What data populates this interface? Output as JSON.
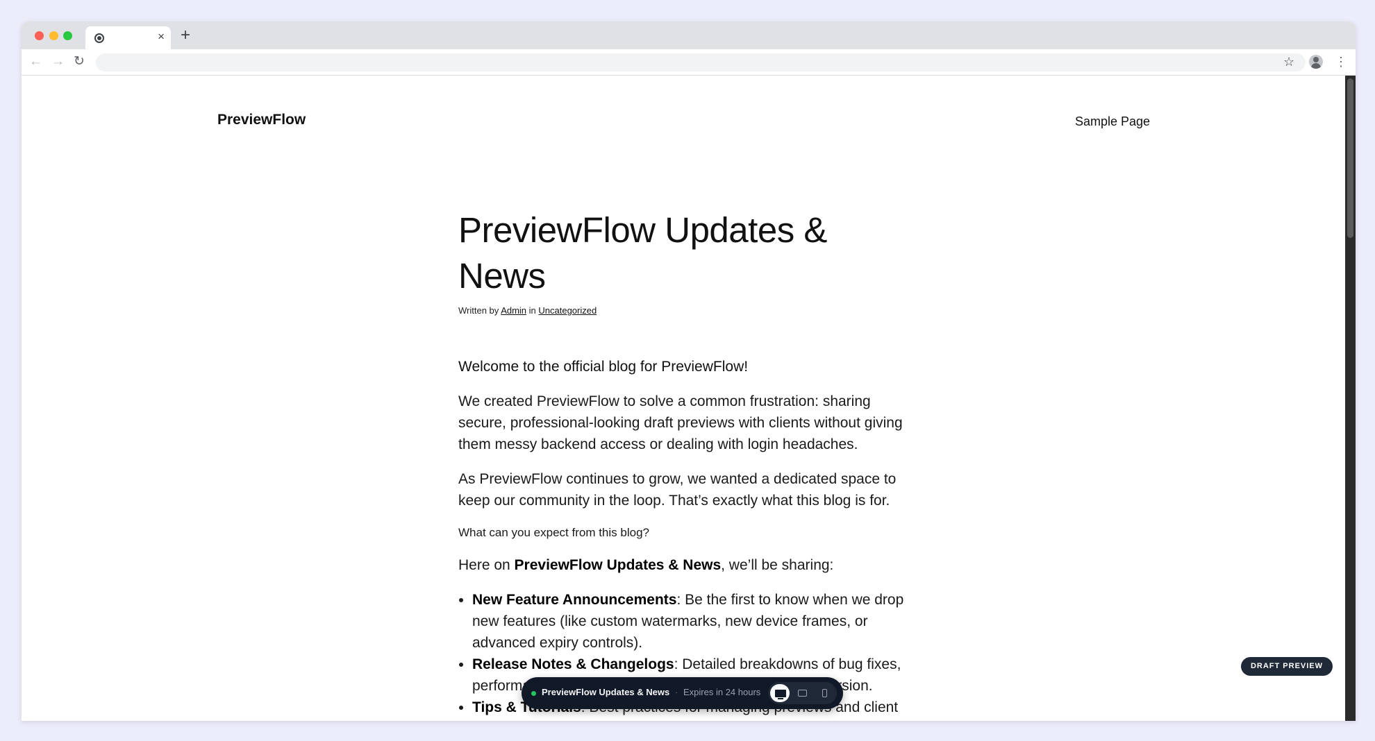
{
  "browser": {
    "tab": {
      "title": "",
      "close_glyph": "×"
    },
    "new_tab_glyph": "+",
    "nav": {
      "back_glyph": "←",
      "forward_glyph": "→",
      "reload_glyph": "↻"
    },
    "star_glyph": "☆",
    "menu_glyph": "⋮"
  },
  "site": {
    "title": "PreviewFlow",
    "nav_link": "Sample Page"
  },
  "post": {
    "title": "PreviewFlow Updates & News",
    "meta_prefix": "Written by ",
    "author": "Admin",
    "meta_in": " in ",
    "category": "Uncategorized",
    "lead": "Welcome to the official blog for PreviewFlow!",
    "para1": "We created PreviewFlow to solve a common frustration: sharing secure, professional-looking draft previews with clients without giving them messy backend access or dealing with login headaches.",
    "para2": "As PreviewFlow continues to grow, we wanted a dedicated space to keep our community in the loop. That’s exactly what this blog is for.",
    "subheading": "What can you expect from this blog?",
    "intro_prefix": "Here on ",
    "intro_strong": "PreviewFlow Updates & News",
    "intro_suffix": ", we’ll be sharing:",
    "bullets": [
      {
        "strong": "New Feature Announcements",
        "text": ": Be the first to know when we drop new features (like custom watermarks, new device frames, or advanced expiry controls)."
      },
      {
        "strong": "Release Notes & Changelogs",
        "text": ": Detailed breakdowns of bug fixes, performance improvements, and updates in our latest version."
      },
      {
        "strong": "Tips & Tutorials",
        "text": ": Best practices for managing previews and client feedback."
      }
    ]
  },
  "overlay": {
    "draft_badge": "DRAFT PREVIEW",
    "bar_title": "PreviewFlow Updates & News",
    "separator": "·",
    "expiry": "Expires in 24 hours",
    "status_color": "#22c55e"
  }
}
